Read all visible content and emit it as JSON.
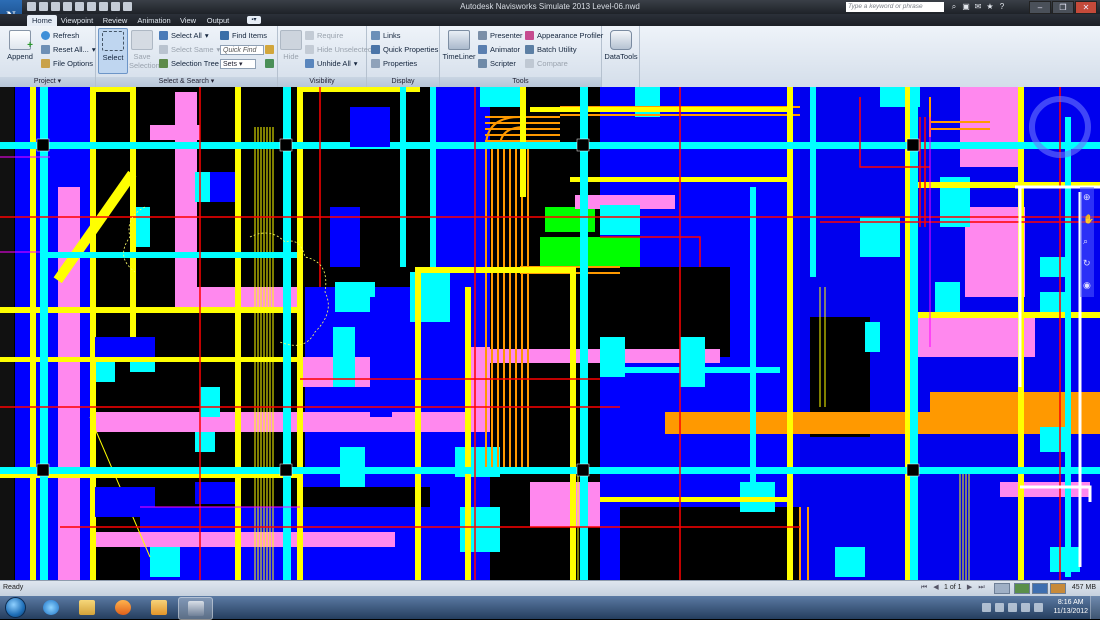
{
  "window": {
    "title": "Autodesk Navisworks Simulate 2013    Level-06.nwd",
    "search_placeholder": "Type a keyword or phrase"
  },
  "tabs": [
    "Home",
    "Viewpoint",
    "Review",
    "Animation",
    "View",
    "Output"
  ],
  "active_tab": "Home",
  "ribbon": {
    "project": {
      "label": "Project",
      "append": "Append",
      "refresh": "Refresh",
      "reset_all": "Reset All...",
      "file_options": "File Options"
    },
    "select_search": {
      "label": "Select & Search",
      "select": "Select",
      "save_selection": "Save Selection",
      "select_all": "Select All",
      "select_same": "Select Same",
      "selection_tree": "Selection Tree",
      "find_items": "Find Items",
      "quick_find_placeholder": "Quick Find",
      "sets": "Sets"
    },
    "visibility": {
      "label": "Visibility",
      "hide": "Hide",
      "require": "Require",
      "hide_unselected": "Hide Unselected",
      "unhide_all": "Unhide All"
    },
    "display": {
      "label": "Display",
      "links": "Links",
      "quick_properties": "Quick Properties",
      "properties": "Properties"
    },
    "tools": {
      "label": "Tools",
      "timeliner": "TimeLiner",
      "presenter": "Presenter",
      "animator": "Animator",
      "scripter": "Scripter",
      "appearance_profiler": "Appearance Profiler",
      "batch_utility": "Batch Utility",
      "compare": "Compare",
      "datatools": "DataTools"
    }
  },
  "status": {
    "text": "Ready",
    "page": "1 of 1",
    "memory": "457 MB"
  },
  "taskbar": {
    "time": "8:16 AM",
    "date": "11/13/2012"
  },
  "colors": {
    "cyan": "#00ffff",
    "yellow": "#ffff00",
    "blue": "#0000ff",
    "pink": "#ff88ee",
    "orange": "#ff9900",
    "red": "#ff0000",
    "green": "#00ff00"
  }
}
